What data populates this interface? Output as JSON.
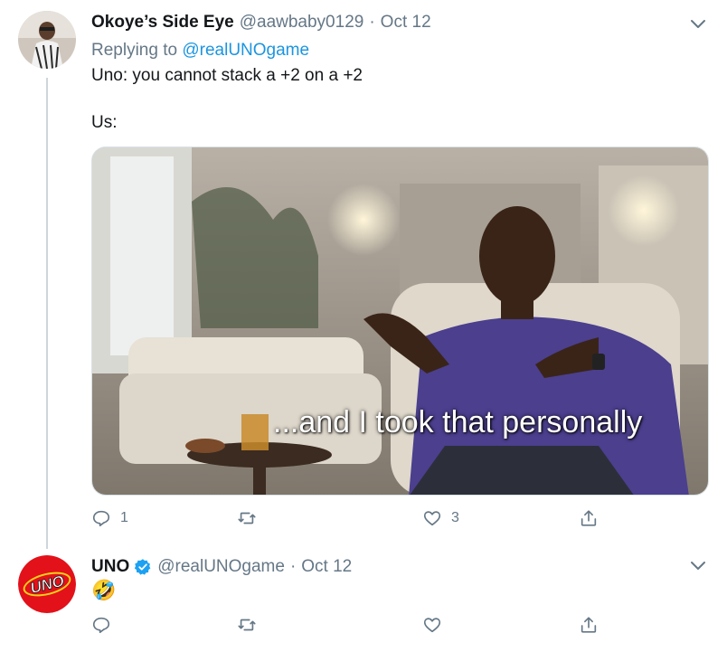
{
  "tweet1": {
    "name": "Okoye’s Side Eye",
    "handle": "@aawbaby0129",
    "dot": "·",
    "date": "Oct 12",
    "replying_prefix": "Replying to",
    "replying_to": "@realUNOgame",
    "text_line1": "Uno: you cannot stack a +2 on a +2",
    "text_line2": "Us:",
    "media_caption": "...and I took that personally",
    "reply_count": "1",
    "retweet_count": "",
    "like_count": "3"
  },
  "tweet2": {
    "name": "UNO",
    "handle": "@realUNOgame",
    "dot": "·",
    "date": "Oct 12",
    "text": "🤣",
    "avatar_logo_text": "UNO",
    "reply_count": "",
    "retweet_count": "",
    "like_count": ""
  },
  "colors": {
    "link": "#1b95e0",
    "muted": "#657786",
    "verified": "#1da1f2",
    "uno_red": "#e3111a",
    "uno_yellow": "#f7d21a"
  },
  "icons": [
    "chevron-down-icon",
    "verified-badge-icon",
    "reply-icon",
    "retweet-icon",
    "like-icon",
    "share-icon"
  ]
}
